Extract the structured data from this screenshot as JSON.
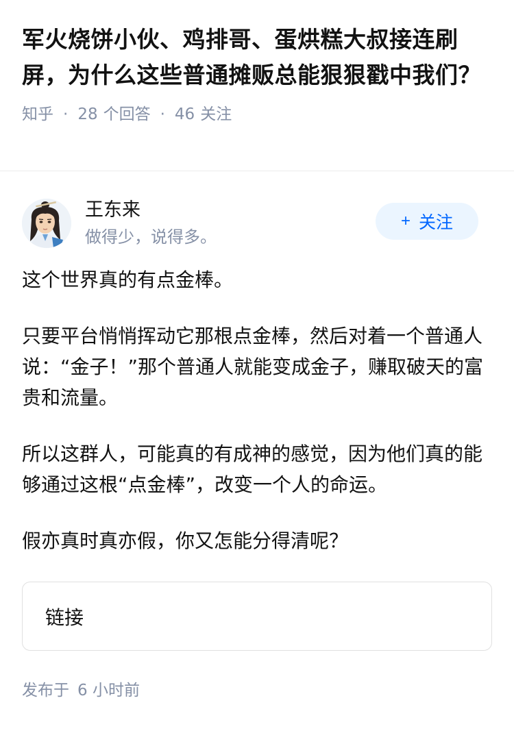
{
  "question": {
    "title": "军火烧饼小伙、鸡排哥、蛋烘糕大叔接连刷屏，为什么这些普通摊贩总能狠狠戳中我们？",
    "source": "知乎",
    "answers_count": "28",
    "answers_label": "个回答",
    "followers_count": "46",
    "followers_label": "关注",
    "separator": "·"
  },
  "author": {
    "name": "王东来",
    "headline": "做得少，说得多。",
    "avatar_icon": "avatar-illustrated-character",
    "follow_plus": "+",
    "follow_label": "关注"
  },
  "answer": {
    "paragraphs": [
      "这个世界真的有点金棒。",
      "只要平台悄悄挥动它那根点金棒，然后对着一个普通人说：“金子！”那个普通人就能变成金子，赚取破天的富贵和流量。",
      "所以这群人，可能真的有成神的感觉，因为他们真的能够通过这根“点金棒”，改变一个人的命运。",
      "假亦真时真亦假，你又怎能分得清呢？"
    ],
    "link_card_label": "链接",
    "publish_prefix": "发布于",
    "publish_time": "6 小时前"
  },
  "colors": {
    "text_primary": "#121212",
    "text_secondary": "#8590a6",
    "accent_blue": "#0066ff",
    "follow_bg": "#ebf5ff",
    "divider": "#ebebeb"
  }
}
